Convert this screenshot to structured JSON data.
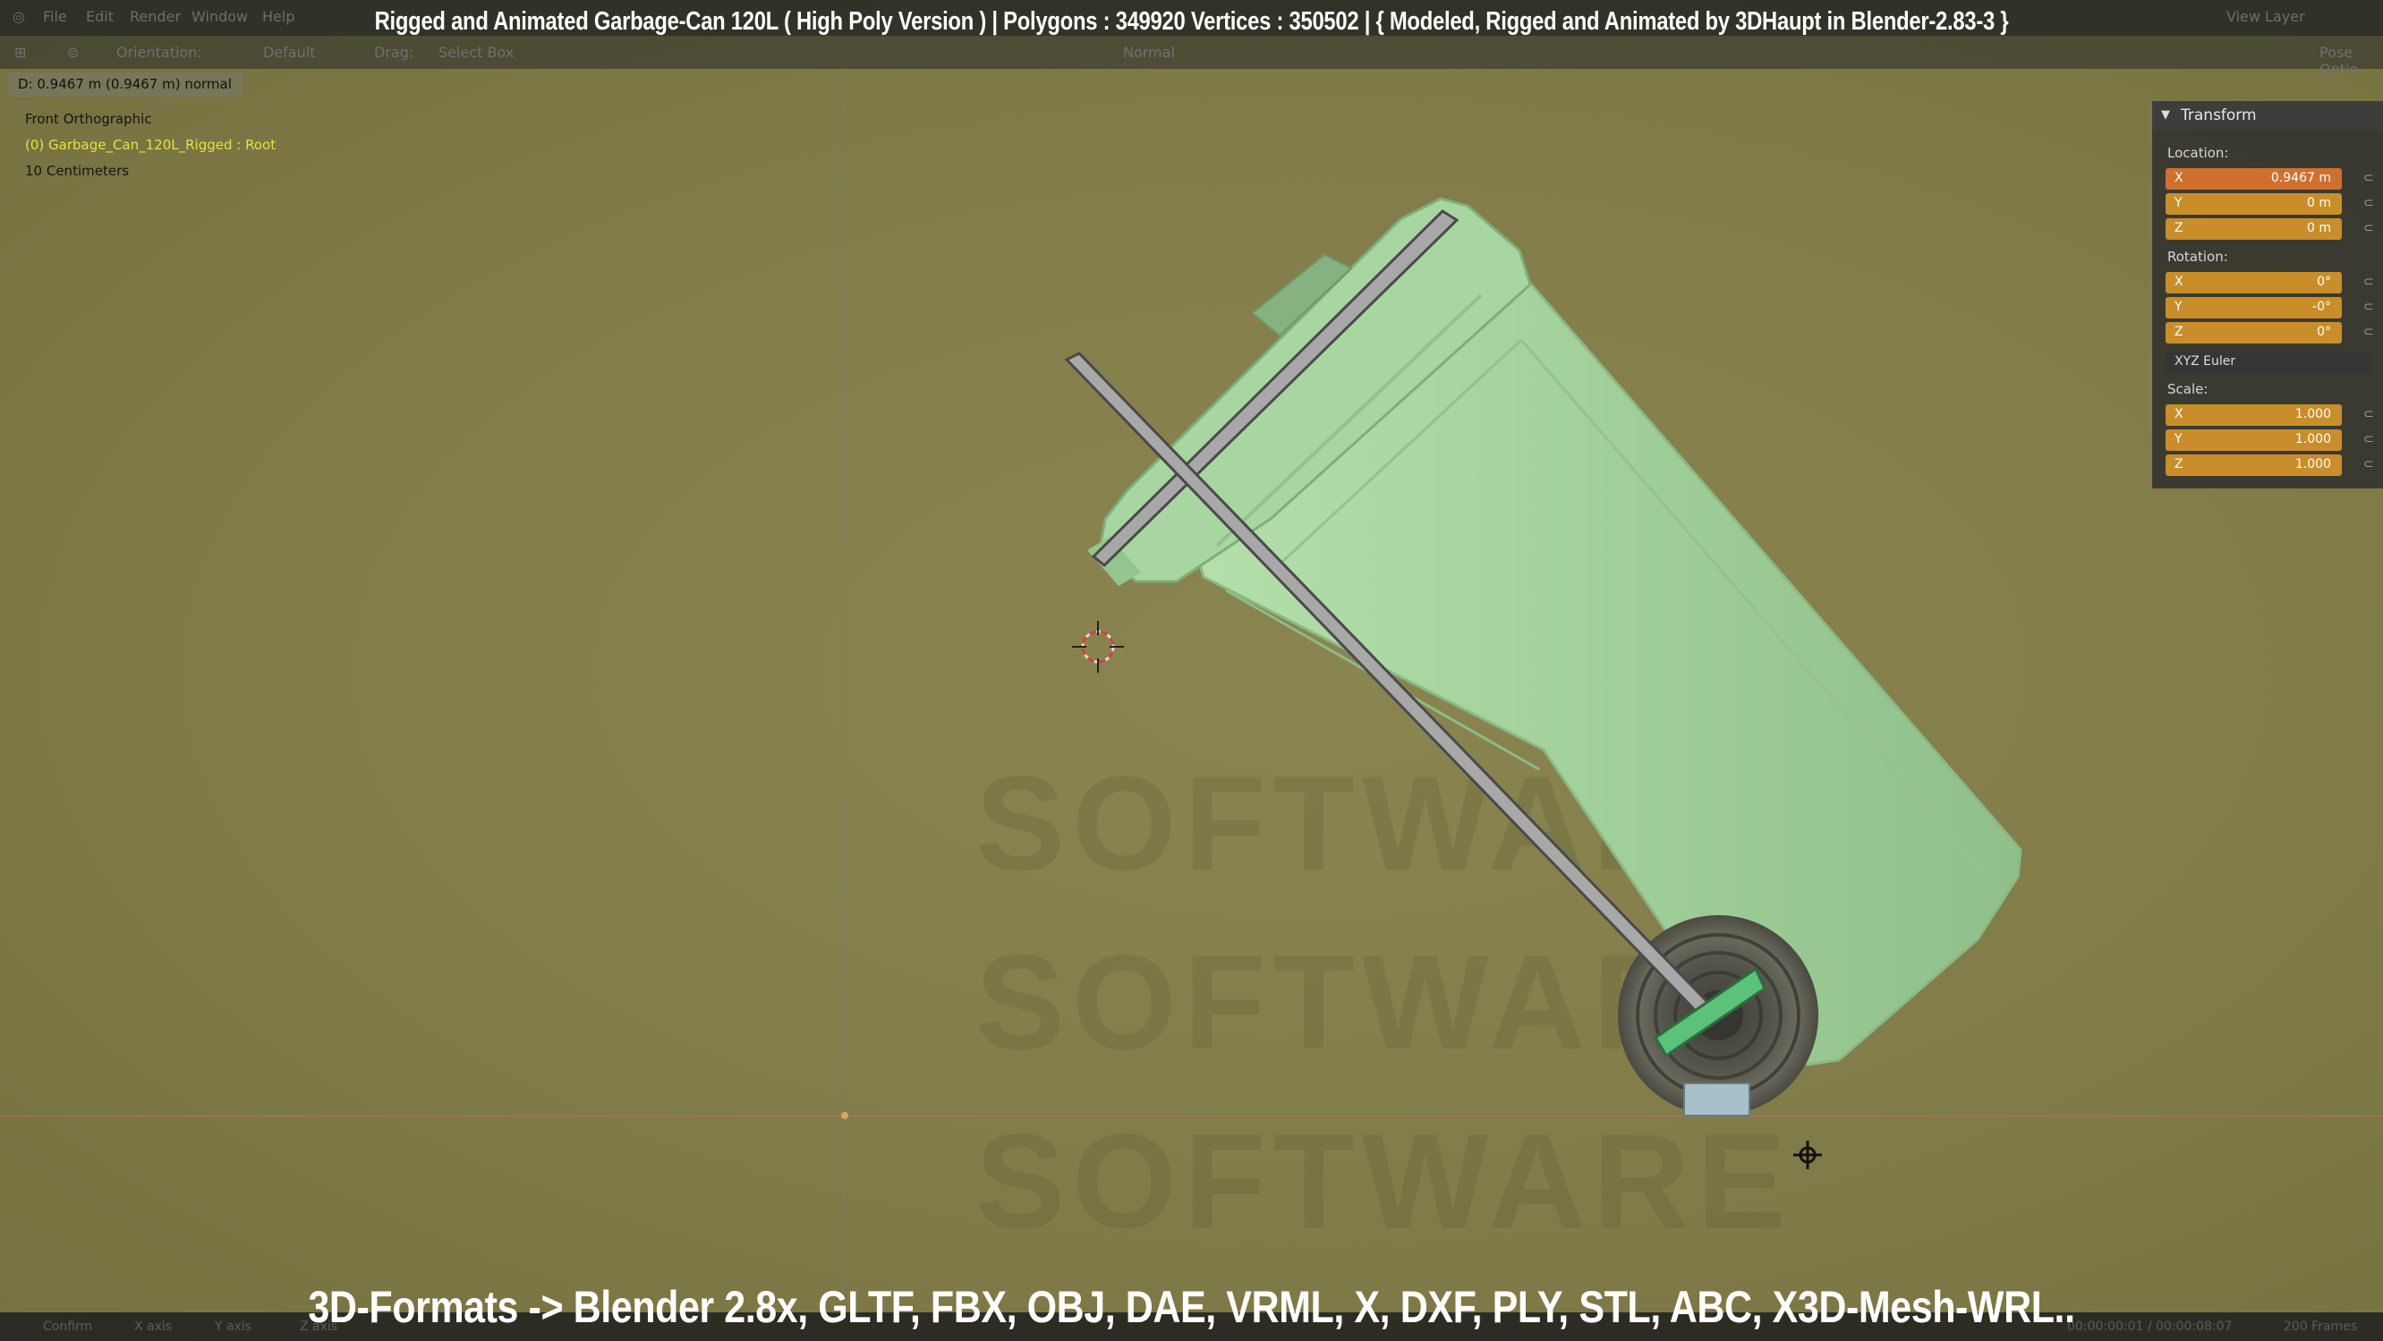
{
  "title": "Rigged and Animated Garbage-Can 120L ( High Poly Version )  |   Polygons : 349920  Vertices : 350502    |   { Modeled, Rigged and Animated by 3DHaupt in Blender-2.83-3 }",
  "subtitle": "3D-Formats -> Blender 2.8x, GLTF, FBX, OBJ, DAE, VRML, X, DXF, PLY, STL, ABC, X3D-Mesh-WRL..",
  "menu": [
    "File",
    "Edit",
    "Render",
    "Window",
    "Help"
  ],
  "toolbar": {
    "orientation": "Orientation:",
    "default": "Default",
    "drag": "Drag:",
    "select_box": "Select Box",
    "normal": "Normal",
    "view_layer": "View Layer",
    "pose_options": "Pose Optio"
  },
  "operator_status": "D: 0.9467 m (0.9467 m) normal",
  "viewport_info": {
    "view": "Front Orthographic",
    "object": "(0) Garbage_Can_120L_Rigged : Root",
    "scale": "10 Centimeters"
  },
  "transform": {
    "header": "Transform",
    "location_label": "Location:",
    "location": [
      {
        "axis": "X",
        "value": "0.9467 m"
      },
      {
        "axis": "Y",
        "value": "0 m"
      },
      {
        "axis": "Z",
        "value": "0 m"
      }
    ],
    "rotation_label": "Rotation:",
    "rotation": [
      {
        "axis": "X",
        "value": "0°"
      },
      {
        "axis": "Y",
        "value": "-0°"
      },
      {
        "axis": "Z",
        "value": "0°"
      }
    ],
    "rotation_mode": "XYZ Euler",
    "scale_label": "Scale:",
    "scale": [
      {
        "axis": "X",
        "value": "1.000"
      },
      {
        "axis": "Y",
        "value": "1.000"
      },
      {
        "axis": "Z",
        "value": "1.000"
      }
    ]
  },
  "status_bar": {
    "confirm": "Confirm",
    "x_axis": "X axis",
    "y_axis": "Y axis",
    "z_axis": "Z axis",
    "time": "00:00:00:01 / 00:00:08:07",
    "frames": "200 Frames"
  },
  "colors": {
    "viewport_bg": "#817c49",
    "can_body": "#9fcf9b",
    "bone_gray": "#a9a9a9",
    "active_field": "#d0702f",
    "field": "#c98e2a",
    "selected_text": "#e3e33a"
  }
}
